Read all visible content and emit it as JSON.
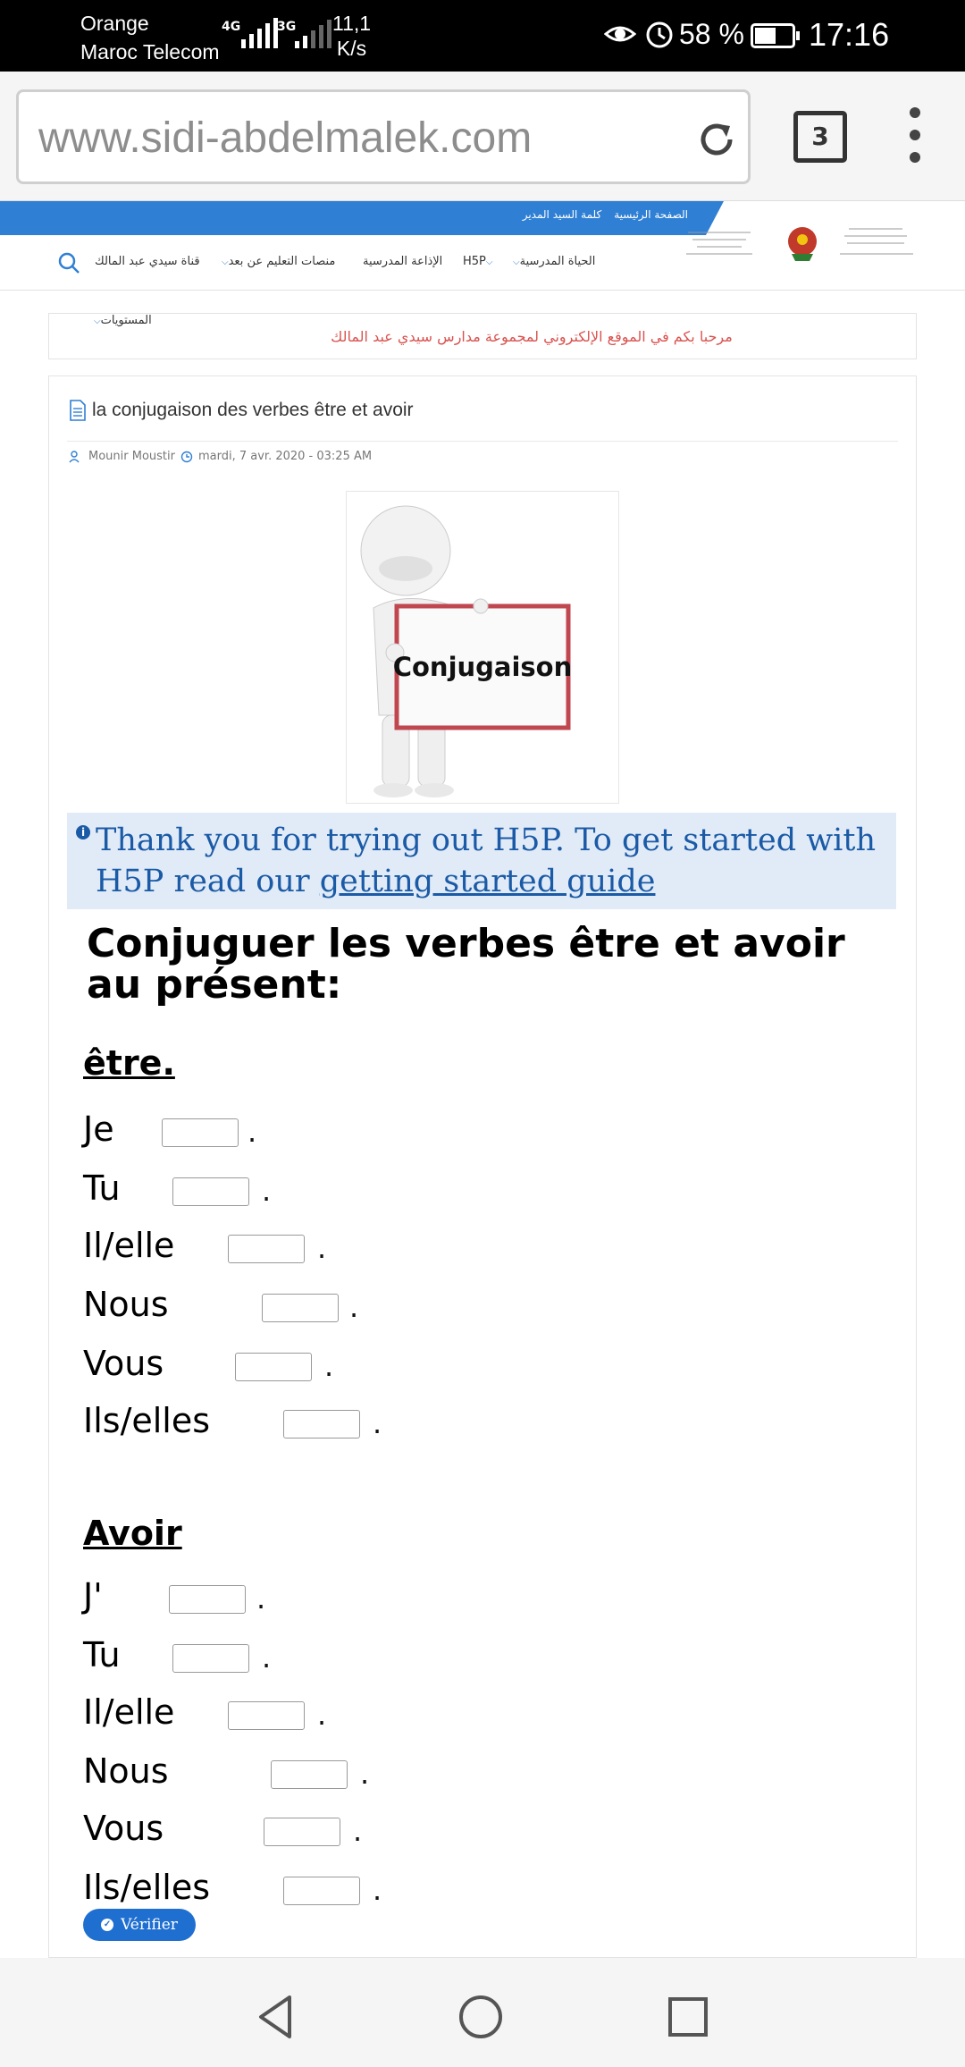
{
  "status_bar": {
    "carrier_line1": "Orange",
    "carrier_line2": "Maroc Telecom",
    "signal1_label": "4G",
    "signal2_label": "3G",
    "speed_value": "11,1",
    "speed_unit": "K/s",
    "battery": "58 %",
    "battery_level": 0.58,
    "time": "17:16"
  },
  "browser": {
    "url": "www.sidi-abdelmalek.com",
    "tab_count": "3"
  },
  "site": {
    "top_links": [
      "الصفحة الرئيسية",
      "كلمة السيد المدير"
    ],
    "nav": {
      "school_life": "الحياة المدرسية",
      "h5p": "H5P",
      "radio": "الإذاعة المدرسية",
      "remote": "منصات التعليم عن بعد",
      "channel": "قناة سيدي عبد المالك",
      "levels": "المستويات"
    },
    "welcome": "مرحبا بكم في الموقع الإلكتروني لمجموعة مدارس سيدي عبد المالك"
  },
  "article": {
    "title": "la conjugaison des verbes être et avoir",
    "author": "Mounir Moustir",
    "date": "mardi, 7 avr. 2020 - 03:25 AM",
    "image_caption": "Conjugaison"
  },
  "h5p": {
    "notice_text": "Thank you for trying out H5P. To get started with H5P read our ",
    "notice_link": "getting started guide",
    "exercise_title": "Conjuguer les verbes être et avoir au présent:",
    "section1_title": "être.",
    "section1_rows": [
      "Je",
      "Tu",
      "Il/elle",
      "Nous",
      "Vous",
      "Ils/elles"
    ],
    "section2_title": "Avoir",
    "section2_rows": [
      "J'",
      "Tu",
      "Il/elle",
      "Nous",
      "Vous",
      "Ils/elles"
    ],
    "dot": ".",
    "verify_button": "Vérifier"
  }
}
